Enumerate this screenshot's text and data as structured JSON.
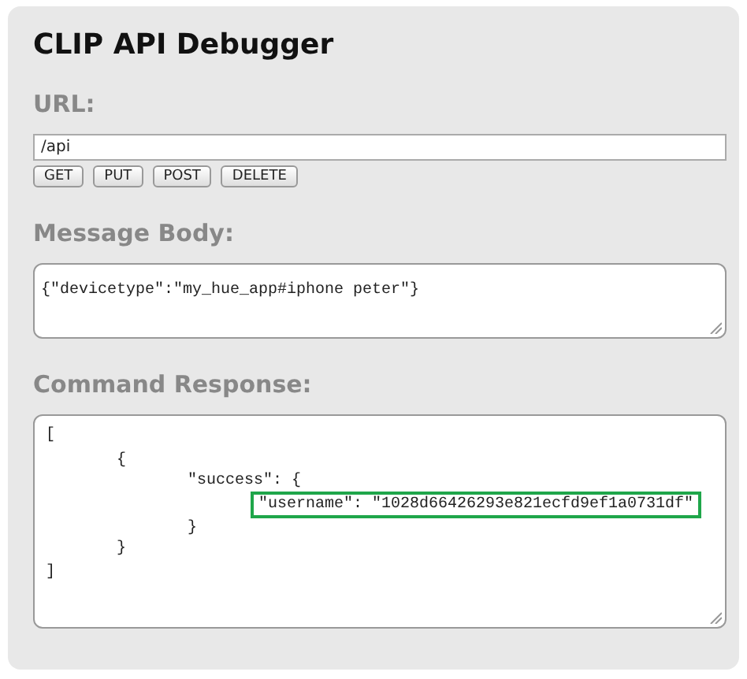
{
  "title": "CLIP API Debugger",
  "url": {
    "label": "URL:",
    "value": "/api"
  },
  "buttons": [
    "GET",
    "PUT",
    "POST",
    "DELETE"
  ],
  "message_body": {
    "label": "Message Body:",
    "value": "{\"devicetype\":\"my_hue_app#iphone peter\"}"
  },
  "command_response": {
    "label": "Command Response:",
    "lines": [
      {
        "text": "[",
        "highlighted": false,
        "children": [
          {
            "text": "{",
            "highlighted": false,
            "children": [
              {
                "text": "\"success\": {",
                "highlighted": false,
                "children": [
                  {
                    "text": "\"username\": \"1028d66426293e821ecfd9ef1a0731df\"",
                    "highlighted": true
                  }
                ]
              },
              {
                "text": "}",
                "highlighted": false
              }
            ]
          },
          {
            "text": "}",
            "highlighted": false
          }
        ]
      },
      {
        "text": "]",
        "highlighted": false
      }
    ]
  }
}
